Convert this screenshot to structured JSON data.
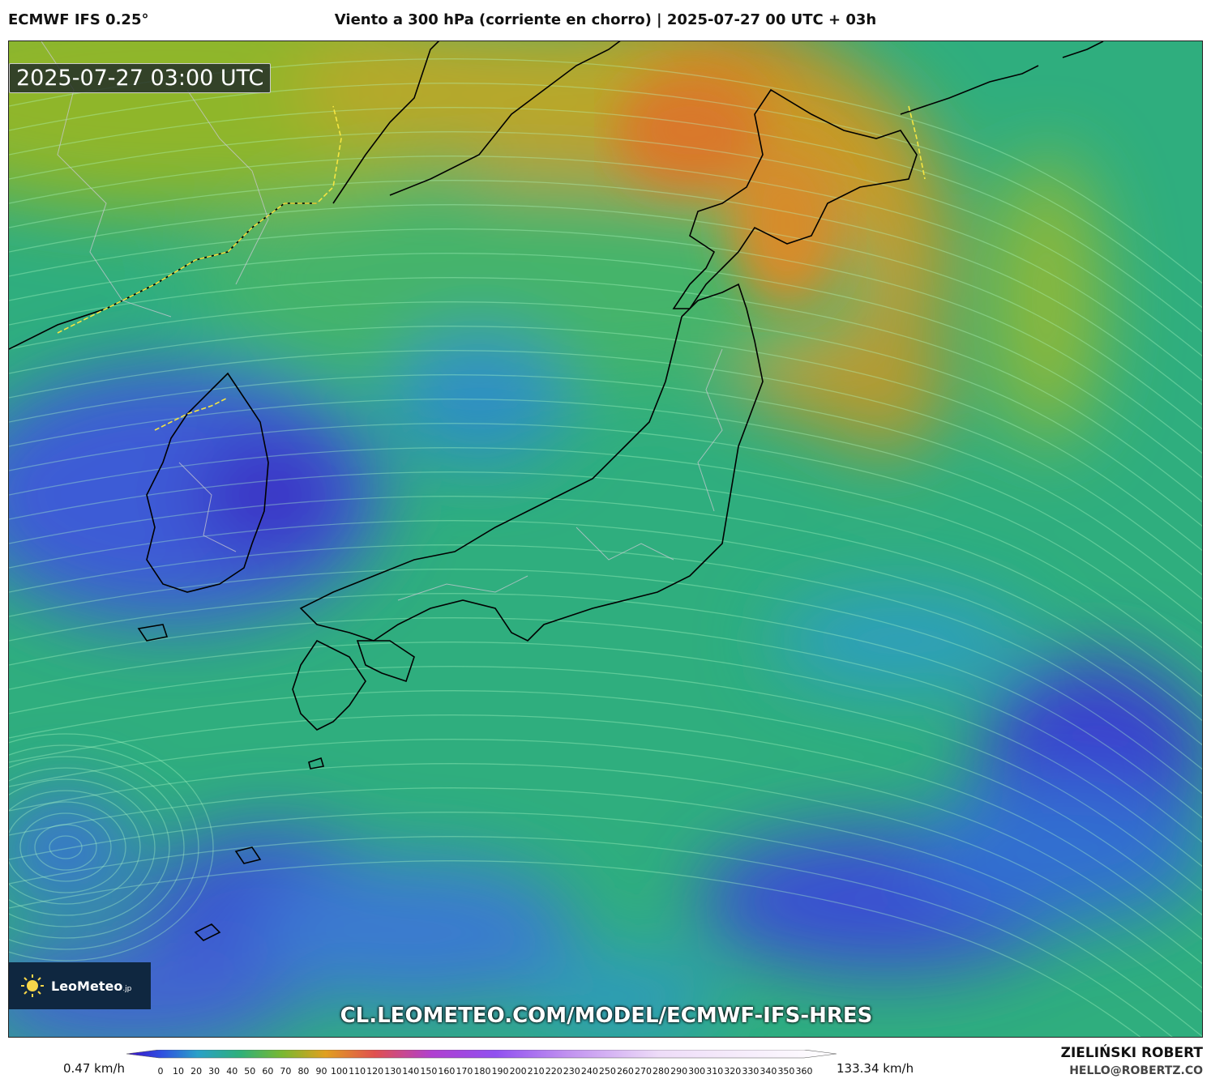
{
  "header": {
    "model": "ECMWF IFS 0.25°",
    "title": "Viento a 300 hPa (corriente en chorro) | 2025-07-27 00 UTC + 03h"
  },
  "map": {
    "timestamp": "2025-07-27 03:00 UTC",
    "watermark_url": "CL.LEOMETEO.COM/MODEL/ECMWF-IFS-HRES",
    "logo_text": "LeoMeteo",
    "logo_suffix": ".jp"
  },
  "legend": {
    "min_label": "0.47 km/h",
    "max_label": "133.34 km/h",
    "ticks": [
      "0",
      "10",
      "20",
      "30",
      "40",
      "50",
      "60",
      "70",
      "80",
      "90",
      "100",
      "110",
      "120",
      "130",
      "140",
      "150",
      "160",
      "170",
      "180",
      "190",
      "200",
      "210",
      "220",
      "230",
      "240",
      "250",
      "260",
      "270",
      "280",
      "290",
      "300",
      "310",
      "320",
      "330",
      "340",
      "350",
      "360"
    ]
  },
  "footer": {
    "author": "ZIELIŃSKI ROBERT",
    "email": "HELLO@ROBERTZ.CO"
  }
}
